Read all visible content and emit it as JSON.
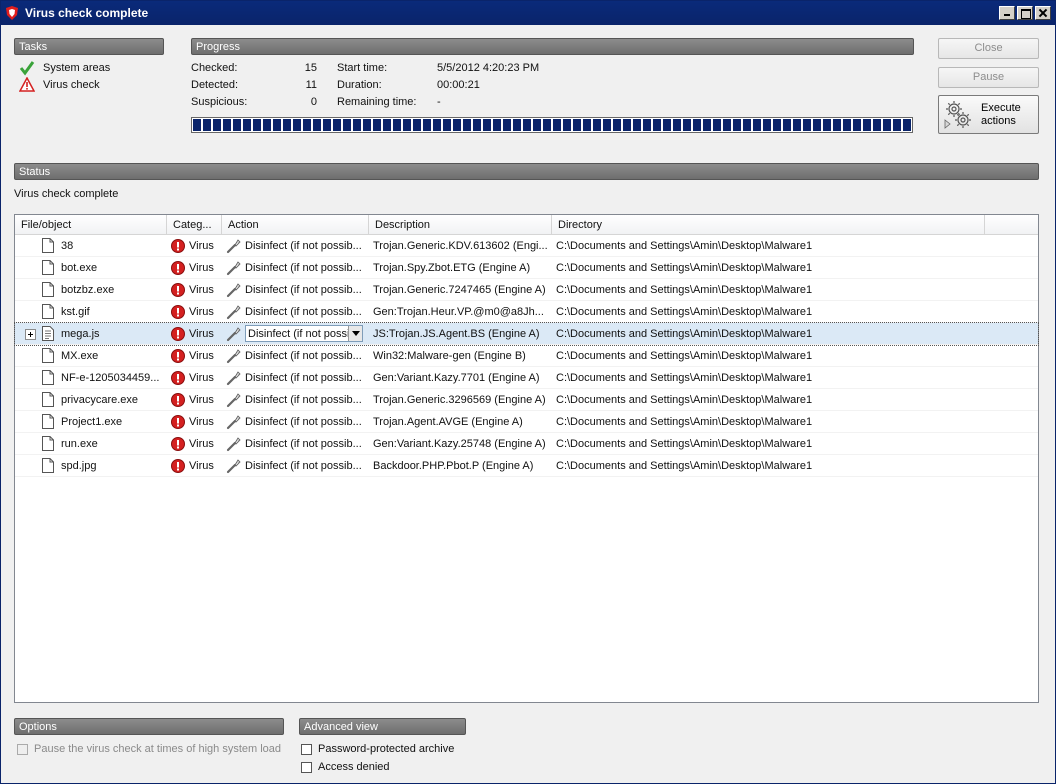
{
  "window": {
    "title": "Virus check complete"
  },
  "tasks": {
    "header": "Tasks",
    "items": [
      {
        "label": "System areas",
        "status_icon": "check-icon"
      },
      {
        "label": "Virus check",
        "status_icon": "warning-icon"
      }
    ]
  },
  "progress": {
    "header": "Progress",
    "checked_label": "Checked:",
    "checked_value": "15",
    "detected_label": "Detected:",
    "detected_value": "11",
    "suspicious_label": "Suspicious:",
    "suspicious_value": "0",
    "start_time_label": "Start time:",
    "start_time_value": "5/5/2012 4:20:23 PM",
    "duration_label": "Duration:",
    "duration_value": "00:00:21",
    "remaining_label": "Remaining time:",
    "remaining_value": "-",
    "fraction_complete": 1.0
  },
  "buttons": {
    "close": "Close",
    "pause": "Pause",
    "execute": "Execute actions"
  },
  "status": {
    "header": "Status",
    "text": "Virus check complete"
  },
  "table": {
    "columns": [
      "File/object",
      "Categ...",
      "Action",
      "Description",
      "Directory"
    ],
    "rows": [
      {
        "file": "38",
        "category": "Virus",
        "action": "Disinfect (if not possib...",
        "description": "Trojan.Generic.KDV.613602 (Engi...",
        "directory": "C:\\Documents and Settings\\Amin\\Desktop\\Malware1"
      },
      {
        "file": "bot.exe",
        "category": "Virus",
        "action": "Disinfect (if not possib...",
        "description": "Trojan.Spy.Zbot.ETG (Engine A)",
        "directory": "C:\\Documents and Settings\\Amin\\Desktop\\Malware1"
      },
      {
        "file": "botzbz.exe",
        "category": "Virus",
        "action": "Disinfect (if not possib...",
        "description": "Trojan.Generic.7247465 (Engine A)",
        "directory": "C:\\Documents and Settings\\Amin\\Desktop\\Malware1"
      },
      {
        "file": "kst.gif",
        "category": "Virus",
        "action": "Disinfect (if not possib...",
        "description": "Gen:Trojan.Heur.VP.@m0@a8Jh...",
        "directory": "C:\\Documents and Settings\\Amin\\Desktop\\Malware1"
      },
      {
        "file": "mega.js",
        "category": "Virus",
        "action": "Disinfect (if not possi",
        "description": "JS:Trojan.JS.Agent.BS (Engine A)",
        "directory": "C:\\Documents and Settings\\Amin\\Desktop\\Malware1",
        "selected": true
      },
      {
        "file": "MX.exe",
        "category": "Virus",
        "action": "Disinfect (if not possib...",
        "description": "Win32:Malware-gen (Engine B)",
        "directory": "C:\\Documents and Settings\\Amin\\Desktop\\Malware1"
      },
      {
        "file": "NF-e-1205034459...",
        "category": "Virus",
        "action": "Disinfect (if not possib...",
        "description": "Gen:Variant.Kazy.7701 (Engine A)",
        "directory": "C:\\Documents and Settings\\Amin\\Desktop\\Malware1"
      },
      {
        "file": "privacycare.exe",
        "category": "Virus",
        "action": "Disinfect (if not possib...",
        "description": "Trojan.Generic.3296569 (Engine A)",
        "directory": "C:\\Documents and Settings\\Amin\\Desktop\\Malware1"
      },
      {
        "file": "Project1.exe",
        "category": "Virus",
        "action": "Disinfect (if not possib...",
        "description": "Trojan.Agent.AVGE (Engine A)",
        "directory": "C:\\Documents and Settings\\Amin\\Desktop\\Malware1"
      },
      {
        "file": "run.exe",
        "category": "Virus",
        "action": "Disinfect (if not possib...",
        "description": "Gen:Variant.Kazy.25748 (Engine A)",
        "directory": "C:\\Documents and Settings\\Amin\\Desktop\\Malware1"
      },
      {
        "file": "spd.jpg",
        "category": "Virus",
        "action": "Disinfect (if not possib...",
        "description": "Backdoor.PHP.Pbot.P (Engine A)",
        "directory": "C:\\Documents and Settings\\Amin\\Desktop\\Malware1"
      }
    ]
  },
  "options": {
    "header": "Options",
    "pause_label": "Pause the virus check at times of high system load"
  },
  "advanced": {
    "header": "Advanced view",
    "password_label": "Password-protected archive",
    "access_label": "Access denied"
  },
  "colors": {
    "title_bar": "#0a246a",
    "section_header": "#7a7a7a",
    "progress_fill": "#0a246a",
    "virus_red": "#d42020",
    "selected_row": "#dbe9f6"
  }
}
